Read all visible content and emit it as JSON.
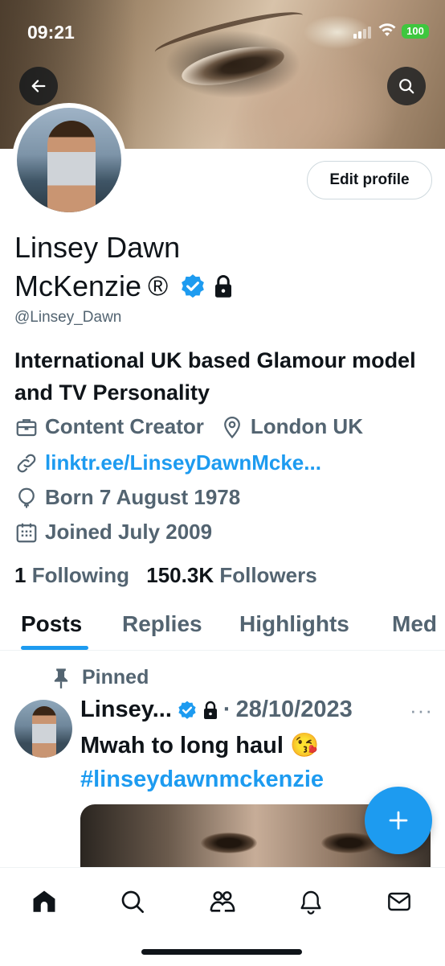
{
  "status_bar": {
    "time": "09:21",
    "battery": "100"
  },
  "header": {
    "back_label": "back",
    "search_label": "search"
  },
  "profile": {
    "name_line1": "Linsey Dawn",
    "name_line2": "McKenzie",
    "name_symbol": "®",
    "handle": "@Linsey_Dawn",
    "edit_button": "Edit profile",
    "bio": "International UK based Glamour model and TV Personality",
    "category": "Content Creator",
    "location": "London UK",
    "link": "linktr.ee/LinseyDawnMcke...",
    "born": "Born 7 August 1978",
    "joined": "Joined July 2009",
    "following_count": "1",
    "following_label": "Following",
    "followers_count": "150.3K",
    "followers_label": "Followers"
  },
  "tabs": [
    {
      "label": "Posts",
      "active": true
    },
    {
      "label": "Replies"
    },
    {
      "label": "Highlights"
    },
    {
      "label": "Med"
    }
  ],
  "pinned_post": {
    "pinned_label": "Pinned",
    "author": "Linsey...",
    "date": "28/10/2023",
    "separator": "·",
    "more": "···",
    "text": "Mwah to long haul 😘",
    "hashtag": "#linseydawnmckenzie"
  },
  "fab_label": "+",
  "bottom_nav": [
    "home-icon",
    "search-icon",
    "communities-icon",
    "notifications-icon",
    "messages-icon"
  ],
  "colors": {
    "accent": "#1d9bf0",
    "text": "#0f1419",
    "secondary": "#536471",
    "battery": "#3ec73e"
  }
}
